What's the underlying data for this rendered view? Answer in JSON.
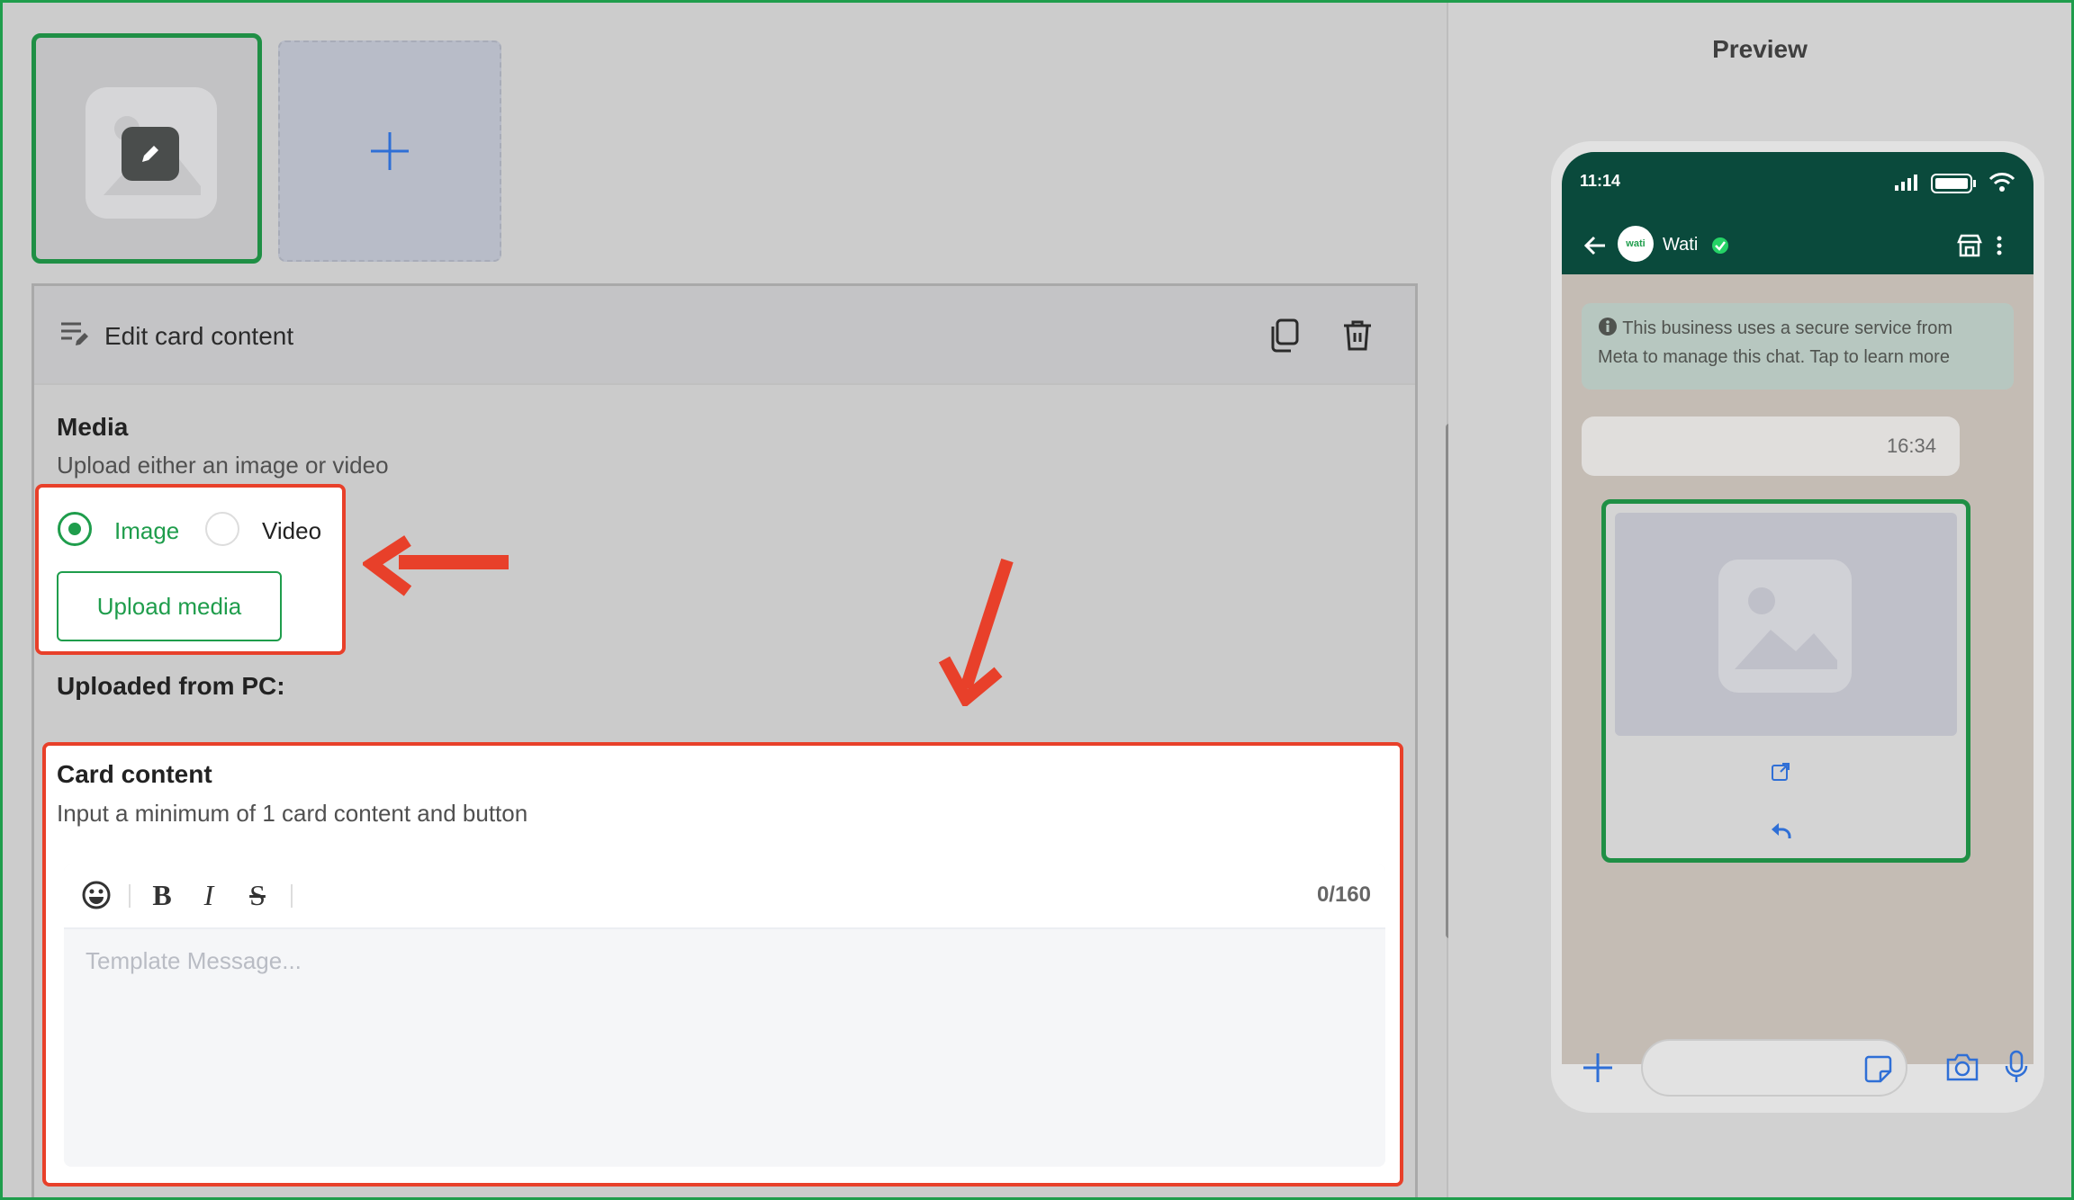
{
  "editor": {
    "panel_title": "Edit card content",
    "media": {
      "heading": "Media",
      "subtitle": "Upload either an image or video",
      "option_image": "Image",
      "option_video": "Video",
      "selected": "Image",
      "upload_button": "Upload media",
      "uploaded_label": "Uploaded from PC:"
    },
    "card_content": {
      "heading": "Card content",
      "subtitle": "Input a minimum of 1 card content and button",
      "counter": "0/160",
      "placeholder": "Template Message...",
      "toolbar": [
        "emoji-icon",
        "bold-icon",
        "italic-icon",
        "strikethrough-icon"
      ]
    }
  },
  "preview": {
    "title": "Preview",
    "status_time": "11:14",
    "contact_name": "Wati",
    "avatar_text": "wati",
    "notice": "This business uses a secure service from Meta to manage this chat. Tap to learn more",
    "bubble_time": "16:34"
  },
  "colors": {
    "accent_green": "#1f9d4c",
    "annotation_red": "#e8402a",
    "whatsapp_header": "#0a4a3c"
  }
}
